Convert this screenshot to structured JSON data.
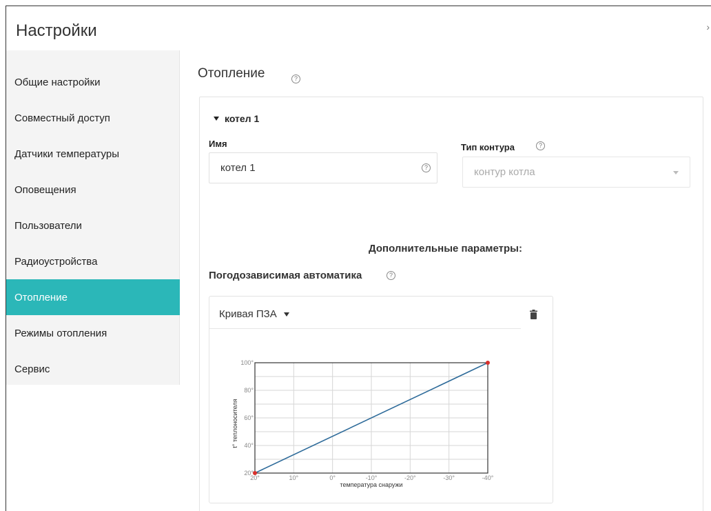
{
  "header": {
    "title": "Настройки",
    "close_glyph": "›"
  },
  "sidebar": {
    "items": [
      {
        "label": "Общие настройки",
        "active": false
      },
      {
        "label": "Совместный доступ",
        "active": false
      },
      {
        "label": "Датчики температуры",
        "active": false
      },
      {
        "label": "Оповещения",
        "active": false
      },
      {
        "label": "Пользователи",
        "active": false
      },
      {
        "label": "Радиоустройства",
        "active": false
      },
      {
        "label": "Отопление",
        "active": true
      },
      {
        "label": "Режимы отопления",
        "active": false
      },
      {
        "label": "Сервис",
        "active": false
      }
    ]
  },
  "main": {
    "section_title": "Отопление",
    "help_glyph": "?",
    "group": {
      "title": "котел 1",
      "name_label": "Имя",
      "name_value": "котел 1",
      "type_label": "Тип контура",
      "type_value": "контур котла",
      "extra_title": "Дополнительные параметры:",
      "weather_label": "Погодозависимая автоматика",
      "curve_select_label": "Кривая ПЗА"
    }
  },
  "colors": {
    "accent": "#2bb7b8",
    "line": "#2e6b9a",
    "point": "#d9302b"
  },
  "chart_data": {
    "type": "line",
    "xlabel": "температура снаружи",
    "ylabel": "t° теплоносителя",
    "x_ticks": [
      "20°",
      "10°",
      "0°",
      "-10°",
      "-20°",
      "-30°",
      "-40°"
    ],
    "x_tick_values": [
      20,
      10,
      0,
      -10,
      -20,
      -30,
      -40
    ],
    "y_ticks": [
      "20°",
      "40°",
      "60°",
      "80°",
      "100°"
    ],
    "y_tick_values": [
      20,
      40,
      60,
      80,
      100
    ],
    "xlim": [
      20,
      -40
    ],
    "ylim": [
      20,
      100
    ],
    "grid": true,
    "series": [
      {
        "x": [
          20,
          -40
        ],
        "y": [
          20,
          100
        ]
      }
    ]
  }
}
